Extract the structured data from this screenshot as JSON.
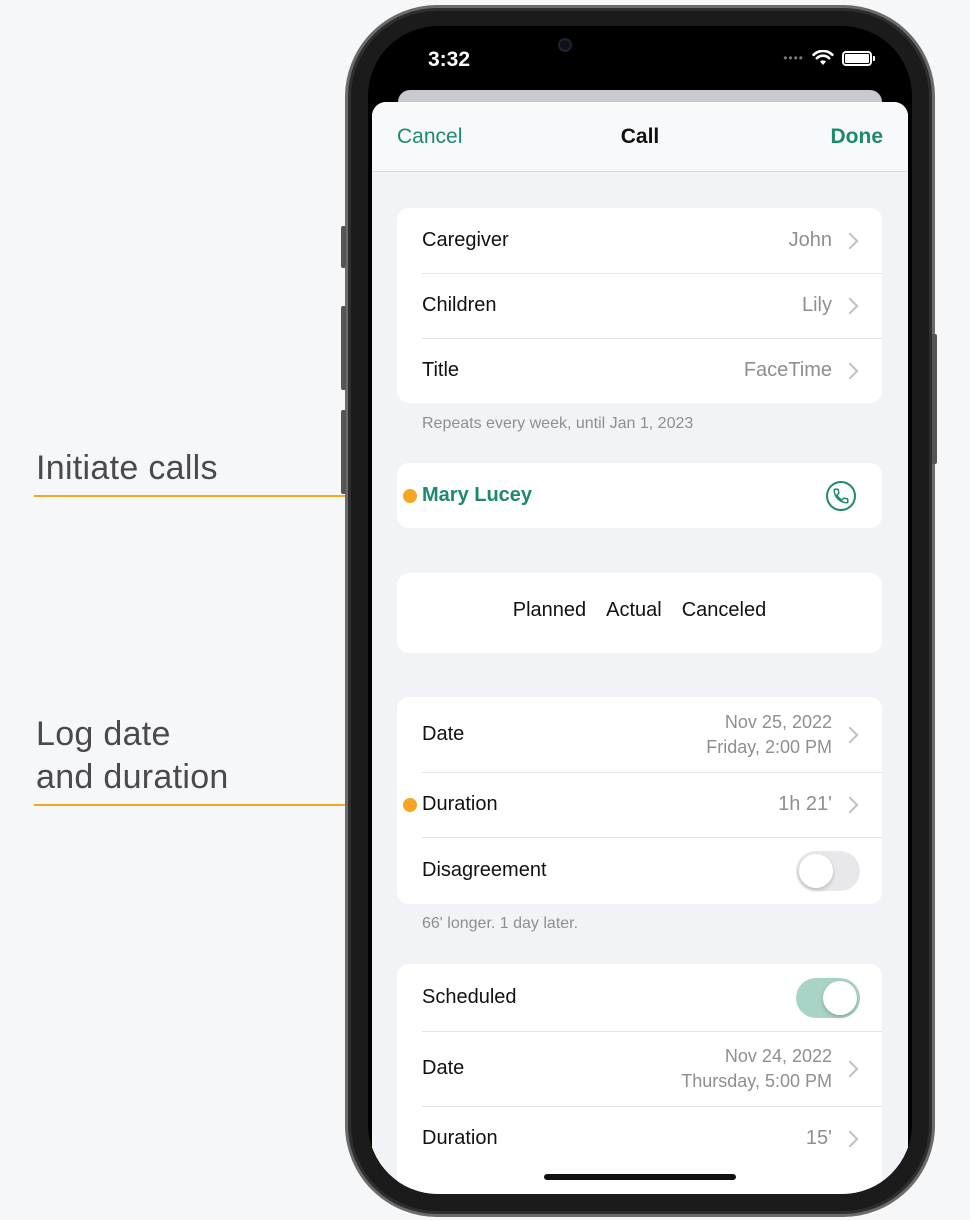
{
  "callouts": {
    "initiate": "Initiate calls",
    "log_line1": "Log date",
    "log_line2": "and duration"
  },
  "status": {
    "time": "3:32"
  },
  "nav": {
    "cancel": "Cancel",
    "title": "Call",
    "done": "Done"
  },
  "details": [
    {
      "label": "Caregiver",
      "value": "John"
    },
    {
      "label": "Children",
      "value": "Lily"
    },
    {
      "label": "Title",
      "value": "FaceTime"
    }
  ],
  "repeat_note": "Repeats every week, until Jan 1, 2023",
  "contact": {
    "name": "Mary Lucey"
  },
  "segments": {
    "planned": "Planned",
    "actual": "Actual",
    "canceled": "Canceled",
    "selected": "Actual"
  },
  "actual": {
    "date_label": "Date",
    "date_line1": "Nov 25, 2022",
    "date_line2": "Friday, 2:00 PM",
    "duration_label": "Duration",
    "duration_value": "1h 21'",
    "disagreement_label": "Disagreement",
    "disagreement_on": false
  },
  "actual_note": "66' longer. 1 day later.",
  "scheduled": {
    "label": "Scheduled",
    "on": true,
    "date_label": "Date",
    "date_line1": "Nov 24, 2022",
    "date_line2": "Thursday, 5:00 PM",
    "duration_label": "Duration",
    "duration_value": "15'"
  },
  "colors": {
    "accent": "#1c8a6e",
    "callout": "#f5a623"
  }
}
